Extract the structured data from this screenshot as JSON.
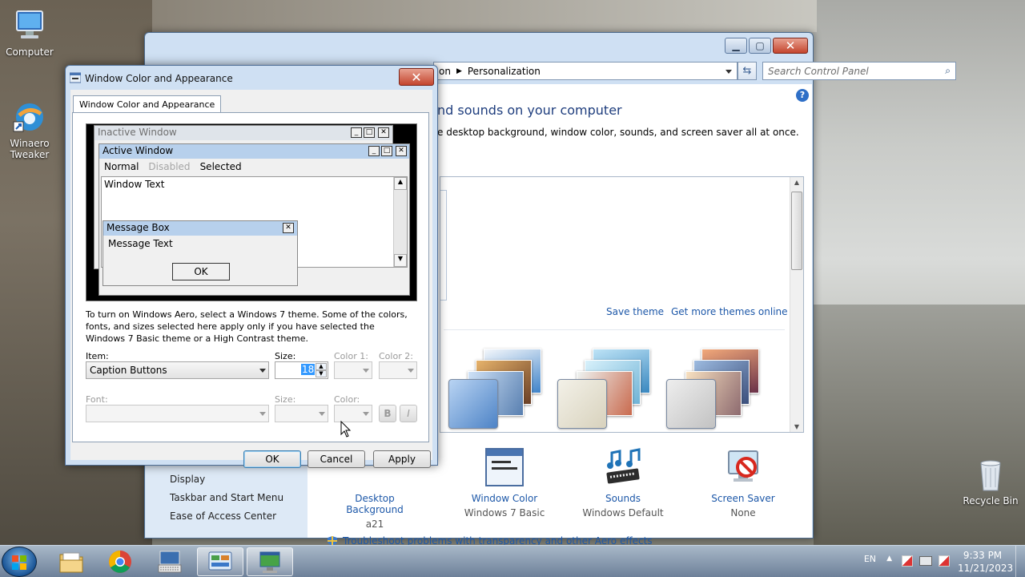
{
  "desktop": {
    "icons": [
      {
        "label": "Computer"
      },
      {
        "label": "Winaero Tweaker"
      },
      {
        "label": "Recycle Bin"
      }
    ]
  },
  "control_panel": {
    "breadcrumb_prefix": "on",
    "breadcrumb_current": "Personalization",
    "search_placeholder": "Search Control Panel",
    "heading": "nd sounds on your computer",
    "subheading": "e desktop background, window color, sounds, and screen saver all at once.",
    "links": {
      "save_theme": "Save theme",
      "get_more": "Get more themes online"
    },
    "sidebar": [
      "Display",
      "Taskbar and Start Menu",
      "Ease of Access Center"
    ],
    "settings": [
      {
        "name": "Desktop Background",
        "value": "a21"
      },
      {
        "name": "Window Color",
        "value": "Windows 7 Basic"
      },
      {
        "name": "Sounds",
        "value": "Windows Default"
      },
      {
        "name": "Screen Saver",
        "value": "None"
      }
    ],
    "troubleshoot": "Troubleshoot problems with transparency and other Aero effects"
  },
  "dialog": {
    "title": "Window Color and Appearance",
    "tab": "Window Color and Appearance",
    "preview": {
      "inactive": "Inactive Window",
      "active": "Active Window",
      "menu": [
        "Normal",
        "Disabled",
        "Selected"
      ],
      "window_text": "Window Text",
      "message_box": "Message Box",
      "message_text": "Message Text",
      "ok": "OK"
    },
    "info": "To turn on Windows Aero, select a Windows 7 theme.  Some of the colors, fonts, and sizes selected here apply only if you have selected the Windows 7 Basic theme or a High Contrast theme.",
    "labels": {
      "item": "Item:",
      "size": "Size:",
      "color1": "Color 1:",
      "color2": "Color 2:",
      "font": "Font:",
      "font_size": "Size:",
      "color": "Color:"
    },
    "item_value": "Caption Buttons",
    "size_value": "18",
    "bold": "B",
    "italic": "I",
    "buttons": {
      "ok": "OK",
      "cancel": "Cancel",
      "apply": "Apply"
    }
  },
  "tray": {
    "lang": "EN",
    "time": "9:33 PM",
    "date": "11/21/2023"
  },
  "colors": {
    "link": "#1c57a8",
    "title_active": "#b7d0ec",
    "close": "#c4452e"
  }
}
